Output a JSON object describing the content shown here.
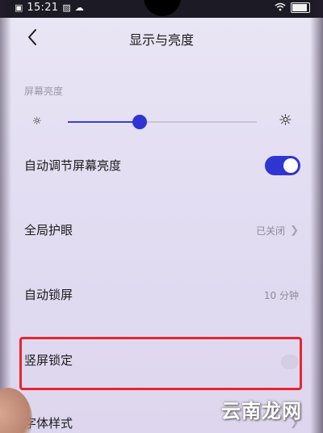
{
  "status_bar": {
    "time": "15:21",
    "icons": [
      "sim-icon",
      "image-icon",
      "cloud-icon",
      "wifi-icon",
      "battery-icon"
    ]
  },
  "header": {
    "back_icon": "chevron-left-icon",
    "title": "显示与亮度"
  },
  "brightness": {
    "section_label": "屏幕亮度",
    "level": 0.38,
    "low_icon": "sun-small-icon",
    "high_icon": "sun-large-icon"
  },
  "rows": {
    "auto_brightness": {
      "label": "自动调节屏幕亮度",
      "enabled": true
    },
    "eye_care": {
      "label": "全局护眼",
      "value": "已关闭"
    },
    "auto_lock": {
      "label": "自动锁屏",
      "value": "10 分钟"
    },
    "portrait_lock": {
      "label": "竖屏锁定",
      "enabled": false
    },
    "font_style": {
      "label": "字体样式"
    }
  },
  "colors": {
    "accent": "#2f35d2",
    "highlight": "#e8252c"
  },
  "watermark": "云南龙网"
}
